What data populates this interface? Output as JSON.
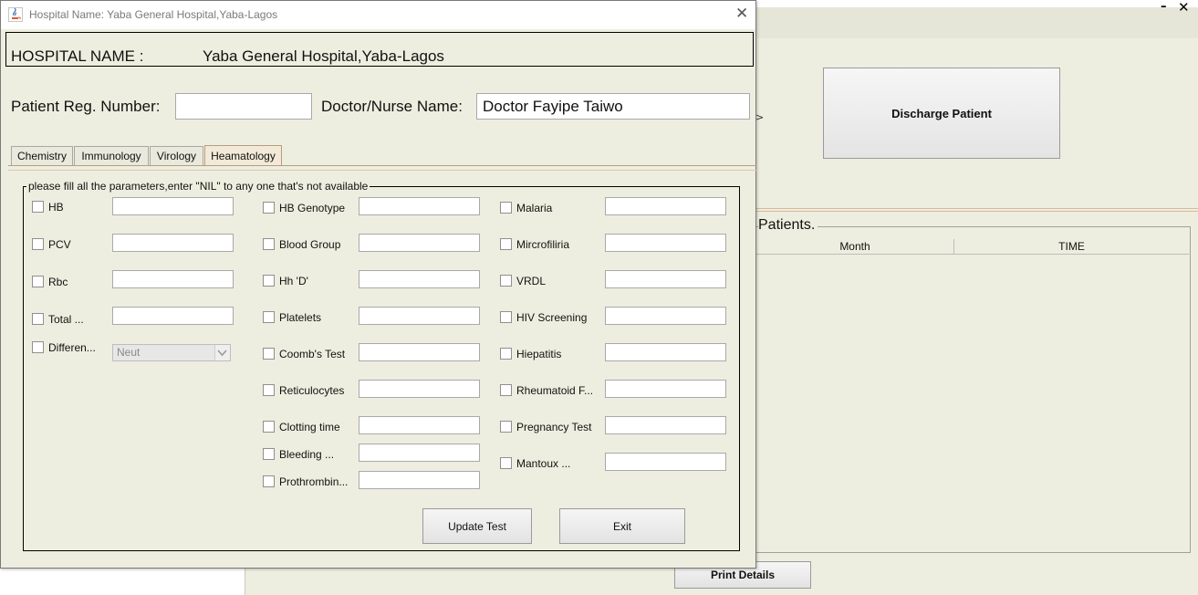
{
  "background": {
    "discharge_label": "Discharge Patient",
    "arrow_glyph": ">",
    "patients_title": "Patients.",
    "columns": [
      "Month",
      "TIME"
    ],
    "print_label": "Print Details",
    "minimize_glyph": "–",
    "close_glyph": "✕"
  },
  "dialog": {
    "title": "Hospital Name: Yaba General Hospital,Yaba-Lagos",
    "close_glyph": "✕",
    "hospital_label": "HOSPITAL NAME :",
    "hospital_value": "Yaba General Hospital,Yaba-Lagos",
    "reg_label": "Patient Reg. Number:",
    "reg_value": "",
    "doctor_label": "Doctor/Nurse Name:",
    "doctor_value": "Doctor Fayipe Taiwo",
    "tabs": [
      "Chemistry",
      "Immunology",
      "Virology",
      "Heamatology"
    ],
    "active_tab": "Heamatology",
    "group_title": "please fill all the parameters,enter \"NIL\" to any one that's not available",
    "col1": [
      "HB",
      "PCV",
      "Rbc",
      "Total ...",
      "Differen..."
    ],
    "col2": [
      "HB Genotype",
      "Blood Group",
      "Hh 'D'",
      "Platelets",
      "Coomb's Test",
      "Reticulocytes",
      "Clotting time",
      "Bleeding ...",
      "Prothrombin..."
    ],
    "col3": [
      "Malaria",
      "Mircrofiliria",
      "VRDL",
      "HIV Screening",
      "Hiepatitis",
      "Rheumatoid F...",
      "Pregnancy Test",
      "Mantoux ..."
    ],
    "differential_selected": "Neut",
    "update_label": "Update Test",
    "exit_label": "Exit"
  },
  "colors": {
    "panel_bg": "#eeeee0",
    "tab_accent": "#b89c7c",
    "title_text": "#7a7a7a"
  }
}
